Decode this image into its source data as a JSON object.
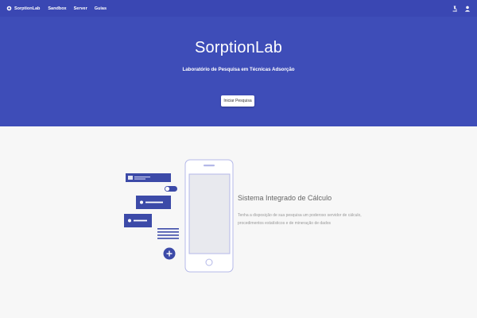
{
  "navbar": {
    "brand": "SorptionLab",
    "links": [
      "Sandbox",
      "Server",
      "Guias"
    ],
    "icons": [
      "microscope-icon",
      "user-icon"
    ]
  },
  "hero": {
    "title": "SorptionLab",
    "subtitle": "Laboratório de Pesquisa em Técnicas Adsorção",
    "button_label": "Iniciar Pesquisa"
  },
  "feature": {
    "title": "Sistema Integrado de Cálculo",
    "description": "Tenha a disposição de sua pesquisa um poderoso servidor de cálculo, procedimentos estatísticos e de mineração de dados"
  },
  "colors": {
    "navbar_bg": "#3a47b3",
    "hero_bg": "#3e4db8",
    "illustration_primary": "#3c4aa8",
    "illustration_outline": "#b4b8e8"
  }
}
